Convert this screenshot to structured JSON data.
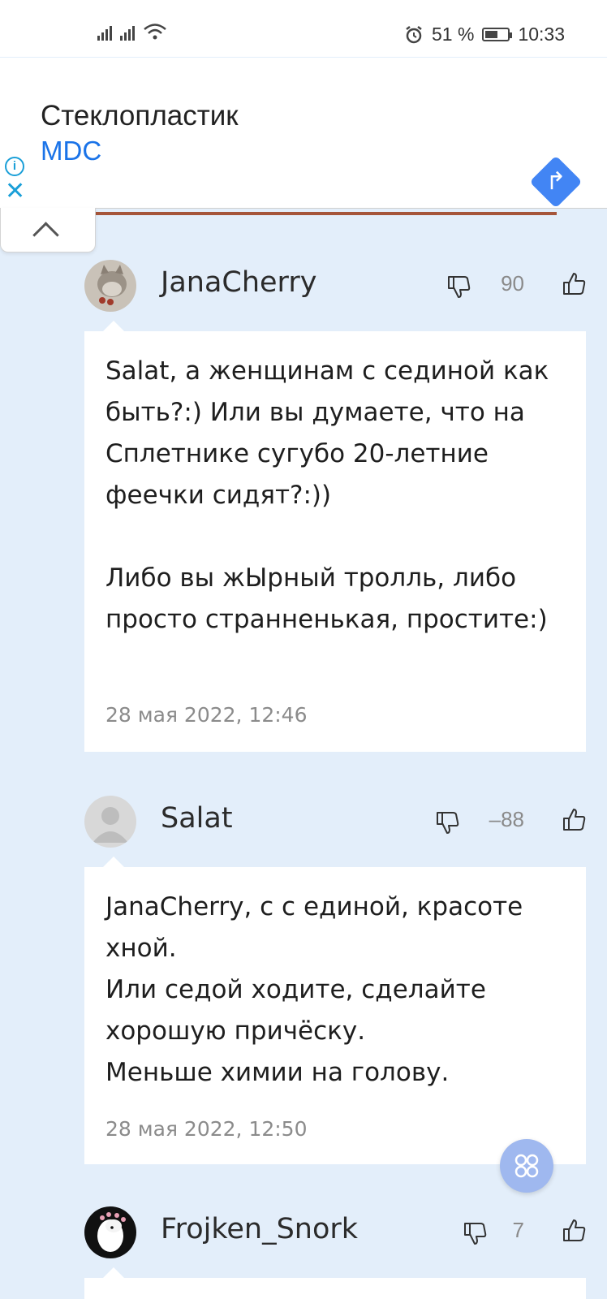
{
  "status_bar": {
    "battery_percent": "51 %",
    "time": "10:33",
    "battery_level": 0.51
  },
  "ad": {
    "title": "Стеклопластик",
    "brand": "MDC",
    "info_icon": "info-icon",
    "close_glyph": "✕",
    "action_icon": "directions-arrow-icon"
  },
  "comments": [
    {
      "username": "JanaCherry",
      "score": "90",
      "text": "Salat, а женщинам с сединой как быть?:) Или вы думаете, что на Сплетнике сугубо 20-летние феечки сидят?:))\n\nЛибо вы жЫрный тролль, либо просто странненькая, простите:)",
      "timestamp": "28 мая 2022, 12:46"
    },
    {
      "username": "Salat",
      "score": "–88",
      "text": "JanaCherry, с с единой, красоте хной.\nИли седой ходите, сделайте хорошую причёску.\nМеньше химии на голову.",
      "timestamp": "28 мая 2022, 12:50"
    },
    {
      "username": "Frojken_Snork",
      "score": "7"
    }
  ],
  "colors": {
    "page_bg": "#e3eefa",
    "link_blue": "#1a73e8",
    "accent": "#a5553a",
    "fab": "#9fb8ef"
  }
}
